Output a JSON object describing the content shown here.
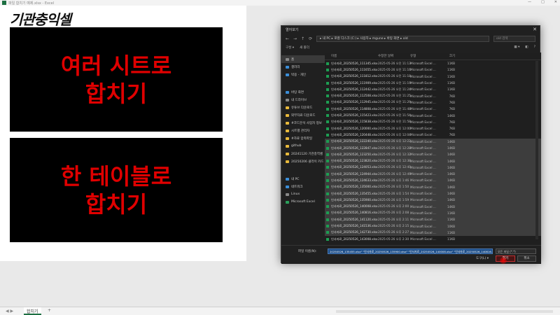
{
  "window": {
    "title": "파일 합치기 예제.xlsx - Excel",
    "controls": [
      "—",
      "□",
      "✕"
    ]
  },
  "sheet": {
    "headline": "기관충익셀",
    "panel1": {
      "line1": "여러 시트로",
      "line2": "합치기"
    },
    "panel2": {
      "line1": "한 테이블로",
      "line2": "합치기"
    },
    "tab_label": "합치기",
    "add_tab": "+",
    "nav": "◀ ▶"
  },
  "dialog": {
    "title": "열어보기",
    "close": "✕",
    "address": "▸ 내 PC ▸ 로컬 디스크 (C:) ▸ 사용자 ▸ mgune ▸ 바탕 화면 ▸ old",
    "search_placeholder": "old 검색",
    "toolbar": {
      "organize": "구성 ▾",
      "new_folder": "새 폴더"
    },
    "nav_items": [
      {
        "label": "홈",
        "icon": "home-icon",
        "color": "gray",
        "selected": true
      },
      {
        "label": "갤러리",
        "icon": "gallery-icon",
        "color": "blue",
        "selected": false
      },
      {
        "label": "박용 - 개인",
        "icon": "cloud-icon",
        "color": "blue",
        "selected": false
      }
    ],
    "nav_items2": [
      {
        "label": "바탕 화면",
        "icon": "desktop-icon",
        "color": "blue"
      },
      {
        "label": "내 드라이브",
        "icon": "drive-icon",
        "color": "gray"
      },
      {
        "label": "유튜브 다운로드",
        "icon": "folder-icon",
        "color": "yellow"
      },
      {
        "label": "외부자료 다운로드",
        "icon": "folder-icon",
        "color": "yellow"
      },
      {
        "label": "#코드분석 사업자 정보",
        "icon": "folder-icon",
        "color": "yellow"
      },
      {
        "label": "시트별 관리자",
        "icon": "folder-icon",
        "color": "yellow"
      },
      {
        "label": "#자료 압축파일",
        "icon": "folder-icon",
        "color": "yellow"
      },
      {
        "label": "github",
        "icon": "folder-icon",
        "color": "yellow"
      },
      {
        "label": "20241120 기관충역셀",
        "icon": "folder-icon",
        "color": "yellow"
      },
      {
        "label": "20250206 클라이 카드",
        "icon": "folder-icon",
        "color": "yellow"
      }
    ],
    "nav_items3": [
      {
        "label": "내 PC",
        "icon": "pc-icon",
        "color": "blue"
      },
      {
        "label": "네트워크",
        "icon": "network-icon",
        "color": "blue"
      },
      {
        "label": "Linux",
        "icon": "linux-icon",
        "color": "gray"
      },
      {
        "label": "Microsoft Excel",
        "icon": "excel-icon",
        "color": "green"
      }
    ],
    "columns": {
      "name": "이름",
      "date": "수정한 날짜",
      "type": "유형",
      "size": "크기"
    },
    "files": [
      {
        "name": "인사자료_20250526_111345.xlsx",
        "date": "2025-05-26 오전 11:13",
        "type": "Microsoft Excel ...",
        "size": "11KB",
        "sel": false
      },
      {
        "name": "인사자료_20250526_111655.xlsx",
        "date": "2025-05-26 오전 11:16",
        "type": "Microsoft Excel ...",
        "size": "11KB",
        "sel": false
      },
      {
        "name": "인사자료_20250526_111812.xlsx",
        "date": "2025-05-26 오전 11:18",
        "type": "Microsoft Excel ...",
        "size": "11KB",
        "sel": false
      },
      {
        "name": "인사자료_20250526_111909.xlsx",
        "date": "2025-05-26 오전 11:19",
        "type": "Microsoft Excel ...",
        "size": "11KB",
        "sel": false
      },
      {
        "name": "인사자료_20250526_112442.xlsx",
        "date": "2025-05-26 오전 11:24",
        "type": "Microsoft Excel ...",
        "size": "11KB",
        "sel": false
      },
      {
        "name": "인사자료_20250526_112508.xlsx",
        "date": "2025-05-26 오전 11:25",
        "type": "Microsoft Excel ...",
        "size": "7KB",
        "sel": false
      },
      {
        "name": "인사자료_20250526_112945.xlsx",
        "date": "2025-05-26 오전 11:29",
        "type": "Microsoft Excel ...",
        "size": "7KB",
        "sel": false
      },
      {
        "name": "인사자료_20250526_114808.xlsx",
        "date": "2025-05-26 오전 11:48",
        "type": "Microsoft Excel ...",
        "size": "7KB",
        "sel": false
      },
      {
        "name": "인사자료_20250526_115423.xlsx",
        "date": "2025-05-26 오전 11:54",
        "type": "Microsoft Excel ...",
        "size": "14KB",
        "sel": false
      },
      {
        "name": "인사자료_20250526_115838.xlsx",
        "date": "2025-05-26 오전 11:58",
        "type": "Microsoft Excel ...",
        "size": "7KB",
        "sel": false
      },
      {
        "name": "인사자료_20250526_120000.xlsx",
        "date": "2025-05-26 오후 12:00",
        "type": "Microsoft Excel ...",
        "size": "7KB",
        "sel": false
      },
      {
        "name": "인사자료_20250526_120448.xlsx",
        "date": "2025-05-26 오후 12:04",
        "type": "Microsoft Excel ...",
        "size": "7KB",
        "sel": false
      },
      {
        "name": "인사자료_20250526_122240.xlsx",
        "date": "2025-05-26 오후 12:22",
        "type": "Microsoft Excel ...",
        "size": "14KB",
        "sel": true
      },
      {
        "name": "인사자료_20250526_122847.xlsx",
        "date": "2025-05-26 오후 12:28",
        "type": "Microsoft Excel ...",
        "size": "14KB",
        "sel": true
      },
      {
        "name": "인사자료_20250526_123250.xlsx",
        "date": "2025-05-26 오후 12:32",
        "type": "Microsoft Excel ...",
        "size": "14KB",
        "sel": true
      },
      {
        "name": "인사자료_20250526_123820.xlsx",
        "date": "2025-05-26 오후 12:38",
        "type": "Microsoft Excel ...",
        "size": "14KB",
        "sel": true
      },
      {
        "name": "인사자료_20250526_124053.xlsx",
        "date": "2025-05-26 오후 12:40",
        "type": "Microsoft Excel ...",
        "size": "14KB",
        "sel": true
      },
      {
        "name": "인사자료_20250526_124944.xlsx",
        "date": "2025-05-26 오후 12:49",
        "type": "Microsoft Excel ...",
        "size": "14KB",
        "sel": true
      },
      {
        "name": "인사자료_20250526_124633.xlsx",
        "date": "2025-05-26 오후 1:46",
        "type": "Microsoft Excel ...",
        "size": "14KB",
        "sel": true
      },
      {
        "name": "인사자료_20250526_135000.xlsx",
        "date": "2025-05-26 오후 1:50",
        "type": "Microsoft Excel ...",
        "size": "14KB",
        "sel": true
      },
      {
        "name": "인사자료_20250526_135455.xlsx",
        "date": "2025-05-26 오후 1:54",
        "type": "Microsoft Excel ...",
        "size": "14KB",
        "sel": true
      },
      {
        "name": "인사자료_20250526_135900.xlsx",
        "date": "2025-05-26 오후 1:59",
        "type": "Microsoft Excel ...",
        "size": "14KB",
        "sel": true
      },
      {
        "name": "인사자료_20250526_140008.xlsx",
        "date": "2025-05-26 오후 2:00",
        "type": "Microsoft Excel ...",
        "size": "14KB",
        "sel": true
      },
      {
        "name": "인사자료_20250526_140816.xlsx",
        "date": "2025-05-26 오후 2:08",
        "type": "Microsoft Excel ...",
        "size": "11KB",
        "sel": true
      },
      {
        "name": "인사자료_20250526_141120.xlsx",
        "date": "2025-05-26 오후 2:11",
        "type": "Microsoft Excel ...",
        "size": "11KB",
        "sel": true
      },
      {
        "name": "인사자료_20250526_141536.xlsx",
        "date": "2025-05-26 오후 2:15",
        "type": "Microsoft Excel ...",
        "size": "10KB",
        "sel": true
      },
      {
        "name": "인사자료_20250526_142730.xlsx",
        "date": "2025-05-26 오후 2:27",
        "type": "Microsoft Excel ...",
        "size": "11KB",
        "sel": true
      },
      {
        "name": "인사자료_20250526_143008.xlsx",
        "date": "2025-05-26 오후 2:30",
        "type": "Microsoft Excel ...",
        "size": "11KB",
        "sel": false
      }
    ],
    "footer": {
      "filename_label": "파일 이름(N):",
      "filename_value": "20250526_135455.xlsx\" \"인사자료_20250526_135900.xlsx\" \"인사자료_20250526_140008.xlsx\" \"인사자료_20250526_140816.xlsx\"",
      "filetype": "모든 파일 (*.*)",
      "tools": "도구(L) ▾",
      "open": "열기",
      "cancel": "취소"
    }
  }
}
